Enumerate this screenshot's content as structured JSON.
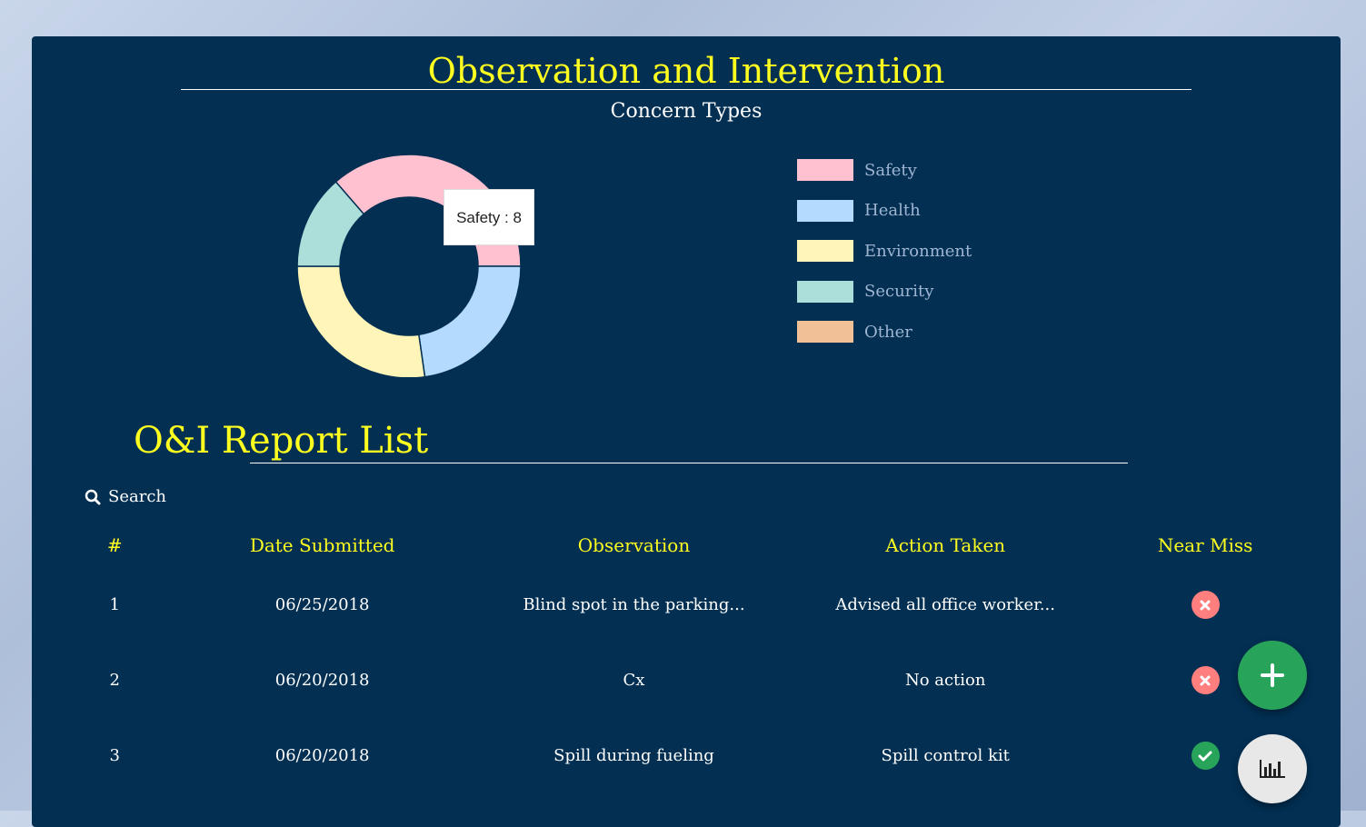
{
  "header": {
    "title": "Observation and Intervention"
  },
  "chart": {
    "title": "Concern Types",
    "tooltip": "Safety : 8"
  },
  "chart_data": {
    "type": "pie",
    "title": "Concern Types",
    "categories": [
      "Safety",
      "Health",
      "Environment",
      "Security",
      "Other"
    ],
    "values": [
      8,
      5,
      6,
      3,
      0
    ],
    "colors": [
      "#ffc0cf",
      "#b4dbfd",
      "#fff5b8",
      "#addfda",
      "#f2c096"
    ],
    "legend": "right"
  },
  "legend": {
    "items": [
      {
        "label": "Safety",
        "color": "#ffc0cf"
      },
      {
        "label": "Health",
        "color": "#b4dbfd"
      },
      {
        "label": "Environment",
        "color": "#fff5b8"
      },
      {
        "label": "Security",
        "color": "#addfda"
      },
      {
        "label": "Other",
        "color": "#f2c096"
      }
    ]
  },
  "report_list": {
    "title": "O&I Report List",
    "search_label": "Search",
    "columns": [
      "#",
      "Date Submitted",
      "Observation",
      "Action Taken",
      "Near Miss"
    ],
    "rows": [
      {
        "num": "1",
        "date": "06/25/2018",
        "observation": "Blind spot in the parking...",
        "action": "Advised all office worker...",
        "near_miss": "no"
      },
      {
        "num": "2",
        "date": "06/20/2018",
        "observation": "Cx",
        "action": "No action",
        "near_miss": "no"
      },
      {
        "num": "3",
        "date": "06/20/2018",
        "observation": "Spill during fueling",
        "action": "Spill control kit",
        "near_miss": "yes"
      }
    ]
  },
  "fabs": {
    "add_icon": "plus-icon",
    "chart_icon": "bar-chart-icon"
  }
}
